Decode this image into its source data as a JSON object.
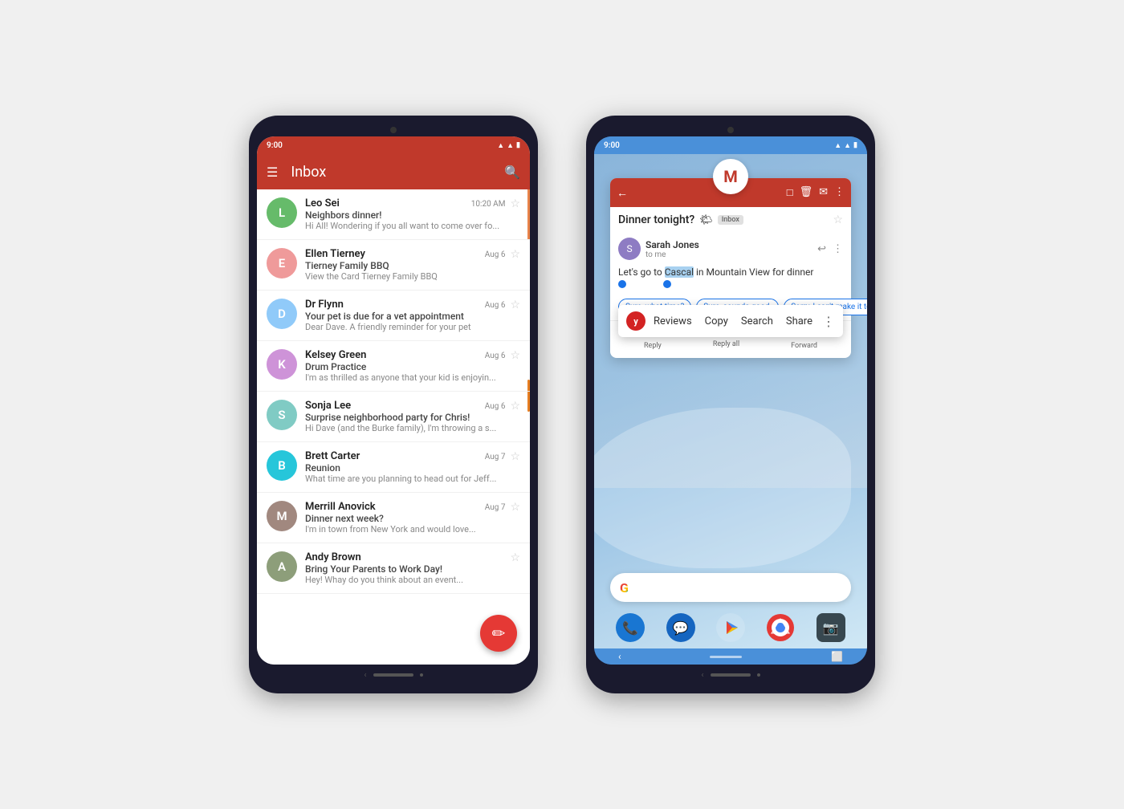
{
  "phone1": {
    "status_time": "9:00",
    "toolbar_title": "Inbox",
    "emails": [
      {
        "sender": "Leo Sei",
        "avatar_color": "#5c9",
        "avatar_initials": "L",
        "time": "10:20 AM",
        "subject": "Neighbors dinner!",
        "preview": "Hi All! Wondering if you all want to come over fo...",
        "has_accent": true
      },
      {
        "sender": "Ellen Tierney",
        "avatar_color": "#e8a",
        "avatar_initials": "E",
        "time": "Aug 6",
        "subject": "Tierney Family BBQ",
        "preview": "View the Card Tierney Family BBQ",
        "has_accent": false
      },
      {
        "sender": "Dr Flynn",
        "avatar_color": "#89c",
        "avatar_initials": "D",
        "time": "Aug 6",
        "subject": "Your pet is due for a vet appointment",
        "preview": "Dear Dave. A friendly reminder for your pet",
        "has_accent": false
      },
      {
        "sender": "Kelsey Green",
        "avatar_color": "#c9a",
        "avatar_initials": "K",
        "time": "Aug 6",
        "subject": "Drum Practice",
        "preview": "I'm as thrilled as anyone that your kid is enjoyin...",
        "has_accent": false
      },
      {
        "sender": "Sonja Lee",
        "avatar_color": "#9bc",
        "avatar_initials": "S",
        "time": "Aug 6",
        "subject": "Surprise neighborhood party for Chris!",
        "preview": "Hi Dave (and the Burke family), I'm throwing a s...",
        "has_accent": false
      },
      {
        "sender": "Brett Carter",
        "avatar_color": "#3ab",
        "avatar_initials": "B",
        "time": "Aug 7",
        "subject": "Reunion",
        "preview": "What time are you planning to head out for Jeff...",
        "has_accent": false
      },
      {
        "sender": "Merrill Anovick",
        "avatar_color": "#a87",
        "avatar_initials": "M",
        "time": "Aug 7",
        "subject": "Dinner next week?",
        "preview": "I'm in town from New York and would love...",
        "has_accent": false
      },
      {
        "sender": "Andy Brown",
        "avatar_color": "#7a6",
        "avatar_initials": "A",
        "time": "",
        "subject": "Bring Your Parents to Work Day!",
        "preview": "Hey! Whay do you think about an event...",
        "has_accent": false
      }
    ]
  },
  "phone2": {
    "status_time": "9:00",
    "gmail_icon_letter": "M",
    "email_subject": "Dinner tonight?",
    "inbox_badge": "Inbox",
    "sender_name": "Sarah Jones",
    "sender_to": "to me",
    "email_body": "Let's go to Cascal in Mountain View for dinner",
    "selected_word": "Cascal",
    "popup_items": [
      {
        "label": "Reviews",
        "is_yelp": true
      },
      {
        "label": "Copy"
      },
      {
        "label": "Search"
      },
      {
        "label": "Share"
      }
    ],
    "smart_replies": [
      "Sure, what time?",
      "Sure, sounds good.",
      "Sorry, I can't make it tonight."
    ],
    "reply_actions": [
      {
        "icon": "↩",
        "label": "Reply"
      },
      {
        "icon": "↩↩",
        "label": "Reply all"
      },
      {
        "icon": "↪",
        "label": "Forward"
      }
    ],
    "dock_icons": [
      {
        "bg": "#1976d2",
        "icon": "📞"
      },
      {
        "bg": "#1565c0",
        "icon": "💬"
      },
      {
        "bg": "#e53935",
        "icon": "▶"
      },
      {
        "bg": "#e53935",
        "icon": "⬤"
      },
      {
        "bg": "#37474f",
        "icon": "📷"
      }
    ]
  }
}
